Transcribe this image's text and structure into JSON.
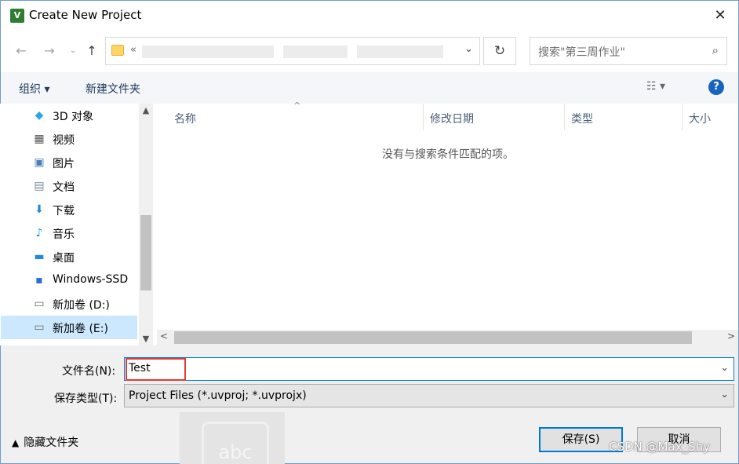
{
  "window": {
    "title": "Create New Project",
    "app_icon": "uvision-icon"
  },
  "nav": {
    "back_icon": "back-arrow-icon",
    "forward_icon": "forward-arrow-icon",
    "up_icon": "up-arrow-icon",
    "address_prefix": "«",
    "search_placeholder": "搜索\"第三周作业\""
  },
  "toolbar": {
    "organize_label": "组织 ▾",
    "new_folder_label": "新建文件夹",
    "view_label": "☷ ▾",
    "help_label": "?"
  },
  "sidebar": {
    "items": [
      {
        "label": "3D 对象",
        "icon": "3d-objects-icon",
        "glyph": "◆",
        "color": "#29a8e0"
      },
      {
        "label": "视频",
        "icon": "video-icon",
        "glyph": "▦",
        "color": "#555555"
      },
      {
        "label": "图片",
        "icon": "pictures-icon",
        "glyph": "▣",
        "color": "#4a7fb5"
      },
      {
        "label": "文档",
        "icon": "documents-icon",
        "glyph": "▤",
        "color": "#7a8a9a"
      },
      {
        "label": "下载",
        "icon": "downloads-icon",
        "glyph": "⬇",
        "color": "#1e88e5"
      },
      {
        "label": "音乐",
        "icon": "music-icon",
        "glyph": "♪",
        "color": "#1e88e5"
      },
      {
        "label": "桌面",
        "icon": "desktop-icon",
        "glyph": "▬",
        "color": "#1e88e5"
      },
      {
        "label": "Windows-SSD",
        "icon": "windows-drive-icon",
        "glyph": "▪",
        "color": "#2a6fd6"
      },
      {
        "label": "新加卷 (D:)",
        "icon": "drive-icon",
        "glyph": "▭",
        "color": "#666666"
      },
      {
        "label": "新加卷 (E:)",
        "icon": "drive-icon",
        "glyph": "▭",
        "color": "#666666"
      }
    ]
  },
  "columns": [
    {
      "label": "名称"
    },
    {
      "label": "修改日期"
    },
    {
      "label": "类型"
    },
    {
      "label": "大小"
    }
  ],
  "empty_message": "没有与搜索条件匹配的项。",
  "form": {
    "filename_label": "文件名(N):",
    "filename_value": "Test",
    "filetype_label": "保存类型(T):",
    "filetype_value": "Project Files (*.uvproj; *.uvprojx)"
  },
  "footer": {
    "hide_folders_label": "隐藏文件夹",
    "save_label": "保存(S)",
    "cancel_label": "取消"
  },
  "watermark": "CSDN @Max_Shy",
  "ghost_text": "abc"
}
